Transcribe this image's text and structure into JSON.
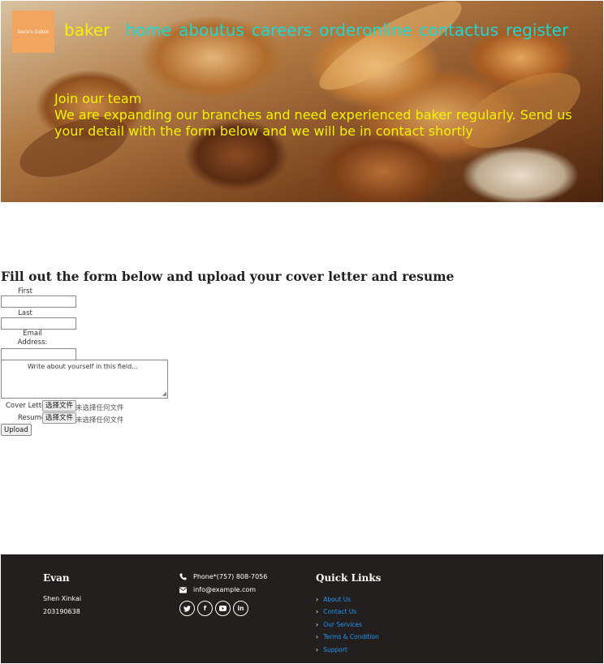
{
  "header": {
    "logo_text": "baca's bakes",
    "brand": "baker",
    "nav": [
      "home",
      "aboutus",
      "careers",
      "orderonline",
      "contactus",
      "register"
    ]
  },
  "hero": {
    "title": "Join our team",
    "description": "We are expanding our branches and need experienced baker regularly. Send us your detail with the form below and we will be in contact shortly"
  },
  "form": {
    "heading": "Fill out the form below and upload your cover letter and resume",
    "first_name_label": "First name:",
    "last_name_label": "Last name:",
    "email_label": "Email Address:",
    "about_placeholder": "Write about yourself in this field...",
    "cover_letter_label": "Cover Letter",
    "resume_label": "Resume",
    "choose_file": "选择文件",
    "no_file": "未选择任何文件",
    "upload_label": "Upload"
  },
  "footer": {
    "name": "Evan",
    "line1": "Shen Xinkai",
    "line2": "203190638",
    "phone": "Phone*(757) 808-7056",
    "email": "info@example.com",
    "socials": [
      "twitter-icon",
      "facebook-icon",
      "youtube-icon",
      "linkedin-icon"
    ],
    "quick_links_title": "Quick Links",
    "quick_links": [
      "About Us",
      "Contact Us",
      "Our Services",
      "Terms & Condition",
      "Support"
    ]
  },
  "colors": {
    "brand_yellow": "#f4f200",
    "nav_cyan": "#1ed8d0",
    "footer_bg": "#231f1e",
    "link_blue": "#2196f3",
    "logo_bg": "#f2a55e"
  }
}
